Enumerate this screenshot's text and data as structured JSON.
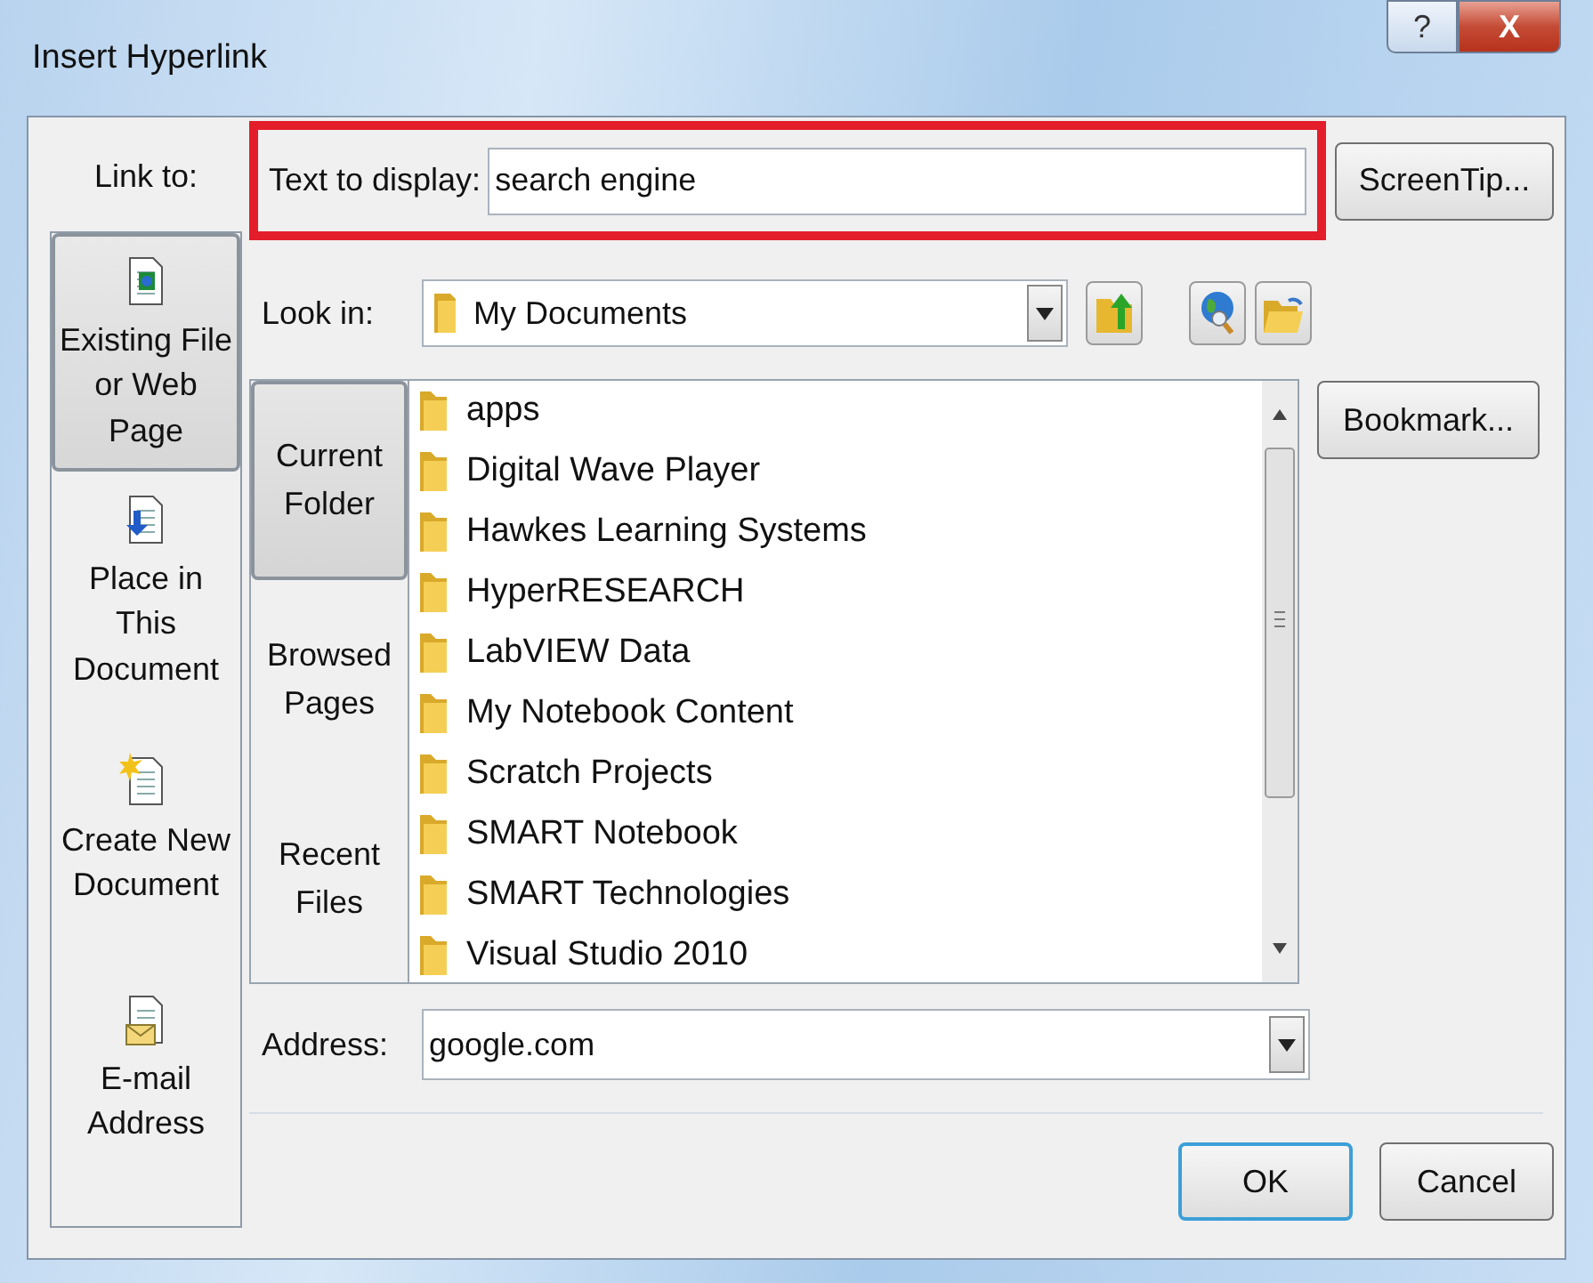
{
  "window": {
    "title": "Insert Hyperlink",
    "controls": [
      {
        "kind": "help",
        "label": "?"
      },
      {
        "kind": "close",
        "label": "X"
      }
    ]
  },
  "link_to": {
    "label": "Link to:",
    "items": [
      {
        "kind": "file",
        "label": "Existing File or Web Page",
        "selected": true
      },
      {
        "kind": "place",
        "label": "Place in This Document",
        "selected": false
      },
      {
        "kind": "new",
        "label": "Create New Document",
        "selected": false
      },
      {
        "kind": "email",
        "label": "E-mail Address",
        "selected": false
      }
    ]
  },
  "text_to_display": {
    "label": "Text to display:",
    "value": "search engine",
    "highlighted": true
  },
  "screentip_button": "ScreenTip...",
  "look_in": {
    "label": "Look in:",
    "value": "My Documents"
  },
  "browse_tabs": [
    {
      "label": "Current Folder",
      "selected": true
    },
    {
      "label": "Browsed Pages",
      "selected": false
    },
    {
      "label": "Recent Files",
      "selected": false
    }
  ],
  "files": [
    "apps",
    "Digital Wave Player",
    "Hawkes Learning Systems",
    "HyperRESEARCH",
    "LabVIEW Data",
    "My Notebook Content",
    "Scratch Projects",
    "SMART Notebook",
    "SMART Technologies",
    "Visual Studio 2010"
  ],
  "bookmark_button": "Bookmark...",
  "address": {
    "label": "Address:",
    "value": "google.com"
  },
  "buttons": [
    {
      "label": "OK",
      "default": true
    },
    {
      "label": "Cancel",
      "default": false
    }
  ]
}
